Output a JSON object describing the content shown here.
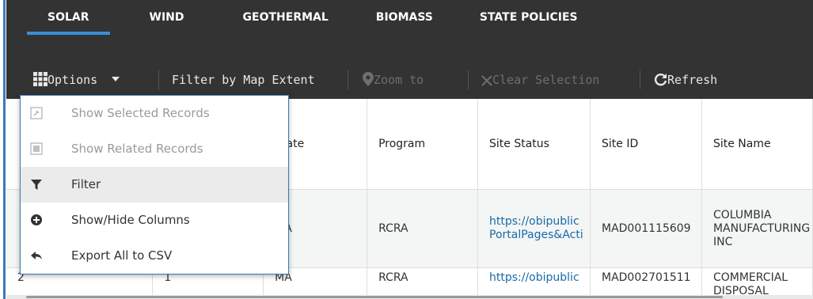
{
  "tabs": [
    "SOLAR",
    "WIND",
    "GEOTHERMAL",
    "BIOMASS",
    "STATE POLICIES"
  ],
  "active_tab": "SOLAR",
  "toolbar": {
    "options": "Options",
    "filter_by_map_extent": "Filter by Map Extent",
    "zoom_to": "Zoom to",
    "clear_selection": "Clear Selection",
    "refresh": "Refresh"
  },
  "menu": {
    "show_selected": "Show Selected Records",
    "show_related": "Show Related Records",
    "filter": "Filter",
    "show_hide_columns": "Show/Hide Columns",
    "export_csv": "Export All to CSV"
  },
  "table": {
    "columns": [
      "",
      "",
      "State",
      "Program",
      "Site Status",
      "Site ID",
      "Site Name"
    ],
    "rows": [
      [
        "",
        "",
        "MA",
        "RCRA",
        "https://obipublic\nPortalPages&Acti",
        "MAD001115609",
        "COLUMBIA\nMANUFACTURING\nINC"
      ],
      [
        "2",
        "1",
        "MA",
        "RCRA",
        "https://obipublic",
        "MAD002701511",
        "COMMERCIAL\nDISPOSAL"
      ]
    ]
  },
  "colors": {
    "toolbar_bg": "#333333",
    "accent": "#3b8fd4",
    "link": "#1a6aa8"
  }
}
